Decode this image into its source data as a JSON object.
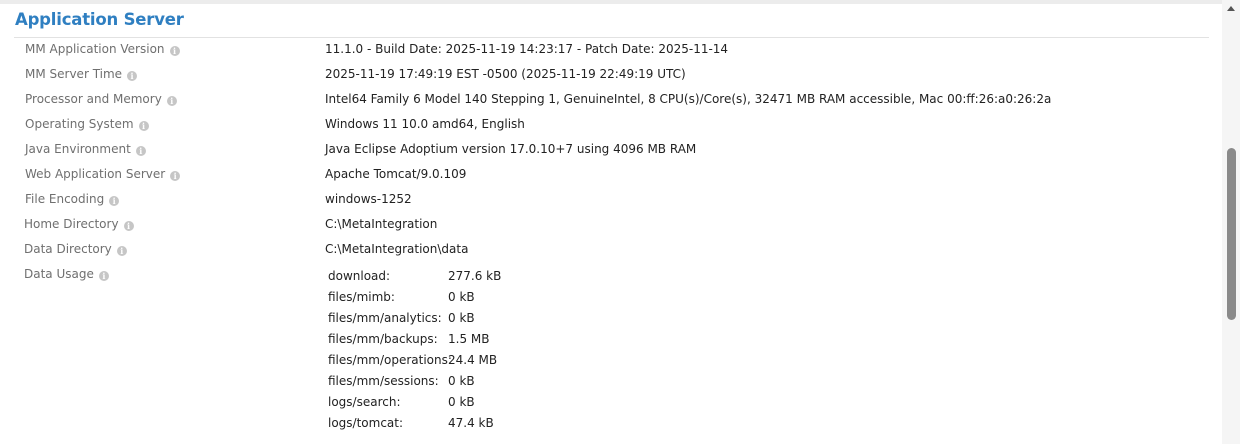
{
  "section": {
    "title": "Application Server"
  },
  "properties": [
    {
      "label": "MM Application Version",
      "value": "11.1.0 - Build Date: 2025-11-19 14:23:17 - Patch Date: 2025-11-14"
    },
    {
      "label": "MM Server Time",
      "value": "2025-11-19 17:49:19 EST -0500 (2025-11-19 22:49:19 UTC)"
    },
    {
      "label": "Processor and Memory",
      "value": "Intel64 Family 6 Model 140 Stepping 1, GenuineIntel, 8 CPU(s)/Core(s), 32471 MB RAM accessible, Mac 00:ff:26:a0:26:2a"
    },
    {
      "label": "Operating System",
      "value": "Windows 11 10.0 amd64, English"
    },
    {
      "label": "Java Environment",
      "value": "Java Eclipse Adoptium version 17.0.10+7 using 4096 MB RAM"
    },
    {
      "label": "Web Application Server",
      "value": "Apache Tomcat/9.0.109"
    },
    {
      "label": "File Encoding",
      "value": "windows-1252"
    },
    {
      "label": "Home Directory",
      "value": "C:\\MetaIntegration"
    },
    {
      "label": "Data Directory",
      "value": "C:\\MetaIntegration\\data"
    },
    {
      "label": "Data Usage",
      "value": ""
    }
  ],
  "data_usage": [
    {
      "path": "download:",
      "size": "277.6 kB"
    },
    {
      "path": "files/mimb:",
      "size": "0 kB"
    },
    {
      "path": "files/mm/analytics:",
      "size": "0 kB"
    },
    {
      "path": "files/mm/backups:",
      "size": "1.5 MB"
    },
    {
      "path": "files/mm/operations:",
      "size": "24.4 MB"
    },
    {
      "path": "files/mm/sessions:",
      "size": "0 kB"
    },
    {
      "path": "logs/search:",
      "size": "0 kB"
    },
    {
      "path": "logs/tomcat:",
      "size": "47.4 kB"
    }
  ],
  "icons": {
    "info": "info-icon",
    "scroll_up": "scroll-up-arrow-icon"
  },
  "colors": {
    "title": "#2f7fc1",
    "label": "#6f6f6f",
    "value": "#222222",
    "info_icon": "#c6c6c6"
  }
}
